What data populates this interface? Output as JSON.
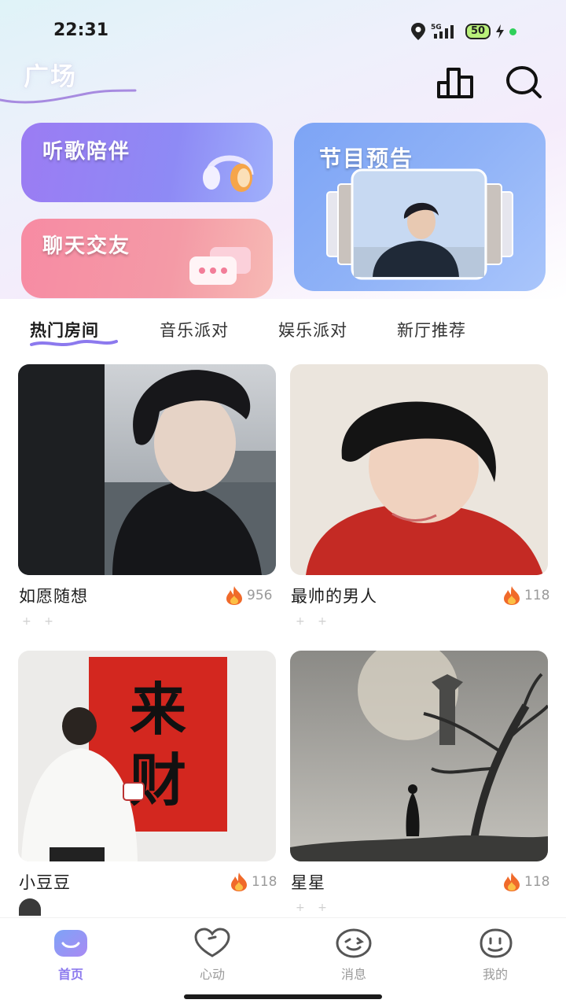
{
  "status": {
    "time": "22:31",
    "network": "5G",
    "battery": "50"
  },
  "header": {
    "title": "广场",
    "icons": [
      "ranking-icon",
      "search-icon"
    ]
  },
  "banners": {
    "listen": {
      "label": "听歌陪伴",
      "icon": "headphones-icon"
    },
    "chat": {
      "label": "聊天交友",
      "icon": "chat-bubble-icon"
    },
    "preview": {
      "label": "节目预告"
    }
  },
  "tabs": [
    {
      "label": "热门房间",
      "active": true
    },
    {
      "label": "音乐派对",
      "active": false
    },
    {
      "label": "娱乐派对",
      "active": false
    },
    {
      "label": "新厅推荐",
      "active": false
    }
  ],
  "rooms": [
    {
      "name": "如愿随想",
      "hot": "956",
      "image": "dark-haired-man-lakeside"
    },
    {
      "name": "最帅的男人",
      "hot": "118",
      "image": "smiling-man-red-shirt"
    },
    {
      "name": "小豆豆",
      "hot": "118",
      "image": "man-with-red-poster",
      "poster_text": "来财"
    },
    {
      "name": "星星",
      "hot": "118",
      "image": "misty-tree-moon"
    }
  ],
  "nav": [
    {
      "label": "首页",
      "active": true
    },
    {
      "label": "心动",
      "active": false
    },
    {
      "label": "消息",
      "active": false
    },
    {
      "label": "我的",
      "active": false
    }
  ],
  "colors": {
    "accent": "#8c79ee",
    "fire": "#f06a2a",
    "banner_purple": "#9b7cf3",
    "banner_pink": "#f78ba3",
    "banner_blue": "#7da4f5"
  }
}
